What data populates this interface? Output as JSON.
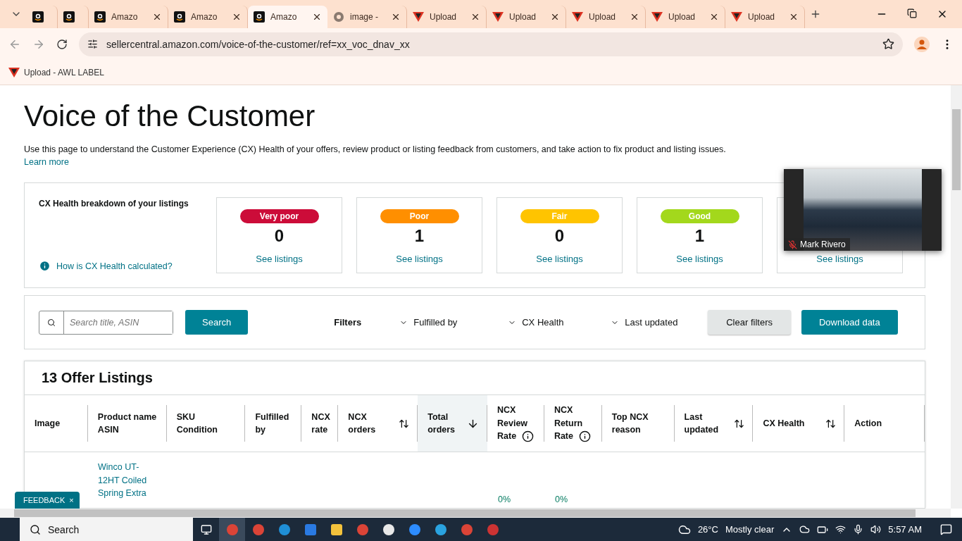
{
  "browser": {
    "tabs": [
      {
        "kind": "amazon",
        "selected": false
      },
      {
        "kind": "amazon",
        "selected": false
      },
      {
        "kind": "amazon",
        "title": "Amazo",
        "selected": false
      },
      {
        "kind": "amazon",
        "title": "Amazo",
        "selected": false
      },
      {
        "kind": "amazon",
        "title": "Amazo",
        "selected": true
      },
      {
        "kind": "image",
        "title": "image -",
        "selected": false
      },
      {
        "kind": "upload",
        "title": "Upload",
        "selected": false
      },
      {
        "kind": "upload",
        "title": "Upload",
        "selected": false
      },
      {
        "kind": "upload",
        "title": "Upload",
        "selected": false
      },
      {
        "kind": "upload",
        "title": "Upload",
        "selected": false
      },
      {
        "kind": "upload",
        "title": "Upload",
        "selected": false
      }
    ],
    "url": "sellercentral.amazon.com/voice-of-the-customer/ref=xx_voc_dnav_xx",
    "bookmarks": [
      {
        "label": "Upload - AWL LABEL"
      }
    ]
  },
  "page": {
    "title": "Voice of the Customer",
    "intro": "Use this page to understand the Customer Experience (CX) Health of your offers, review product or listing feedback from customers, and take action to fix product and listing issues.",
    "learn_more": "Learn more",
    "health": {
      "heading": "CX Health breakdown of your listings",
      "help_link": "How is CX Health calculated?",
      "cards": [
        {
          "label": "Very poor",
          "color": "#cc0c39",
          "count": "0",
          "link": "See listings"
        },
        {
          "label": "Poor",
          "color": "#ff8f00",
          "count": "1",
          "link": "See listings"
        },
        {
          "label": "Fair",
          "color": "#ffc400",
          "count": "0",
          "link": "See listings"
        },
        {
          "label": "Good",
          "color": "#a3d81c",
          "count": "1",
          "link": "See listings"
        },
        {
          "link": "See listings"
        }
      ]
    },
    "filters": {
      "search_placeholder": "Search title, ASIN",
      "search_button": "Search",
      "label": "Filters",
      "dropdowns": [
        "Fulfilled by",
        "CX Health",
        "Last updated"
      ],
      "clear": "Clear filters",
      "download": "Download data"
    },
    "listings": {
      "title": "13 Offer Listings",
      "columns": [
        {
          "lines": [
            "Image"
          ],
          "sortable": false,
          "info": false,
          "selected": false
        },
        {
          "lines": [
            "Product name",
            "ASIN"
          ],
          "sortable": false,
          "info": false,
          "selected": false
        },
        {
          "lines": [
            "SKU",
            "Condition"
          ],
          "sortable": false,
          "info": false,
          "selected": false
        },
        {
          "lines": [
            "Fulfilled",
            "by"
          ],
          "sortable": false,
          "info": false,
          "selected": false
        },
        {
          "lines": [
            "NCX",
            "rate"
          ],
          "sortable": false,
          "info": false,
          "selected": false
        },
        {
          "lines": [
            "NCX",
            "orders"
          ],
          "sortable": true,
          "info": false,
          "selected": false
        },
        {
          "lines": [
            "Total",
            "orders"
          ],
          "sortable": true,
          "info": false,
          "selected": true
        },
        {
          "lines": [
            "NCX",
            "Review",
            "Rate"
          ],
          "sortable": false,
          "info": true,
          "selected": false
        },
        {
          "lines": [
            "NCX",
            "Return",
            "Rate"
          ],
          "sortable": false,
          "info": true,
          "selected": false
        },
        {
          "lines": [
            "Top NCX",
            "reason"
          ],
          "sortable": false,
          "info": false,
          "selected": false
        },
        {
          "lines": [
            "Last",
            "updated"
          ],
          "sortable": true,
          "info": false,
          "selected": false
        },
        {
          "lines": [
            "CX Health"
          ],
          "sortable": true,
          "info": false,
          "selected": false
        },
        {
          "lines": [
            "Action"
          ],
          "sortable": false,
          "info": false,
          "selected": false
        }
      ],
      "rows": [
        {
          "product": "Winco UT-12HT Coiled Spring Extra",
          "ncx_review_rate": "0%",
          "ncx_return_rate": "0%"
        }
      ]
    }
  },
  "video": {
    "name": "Mark Rivero",
    "muted": true
  },
  "feedback": {
    "label": "FEEDBACK",
    "close": "×"
  },
  "taskbar": {
    "search": "Search",
    "temperature": "26°C",
    "weather": "Mostly clear",
    "time": "5:57 AM"
  }
}
